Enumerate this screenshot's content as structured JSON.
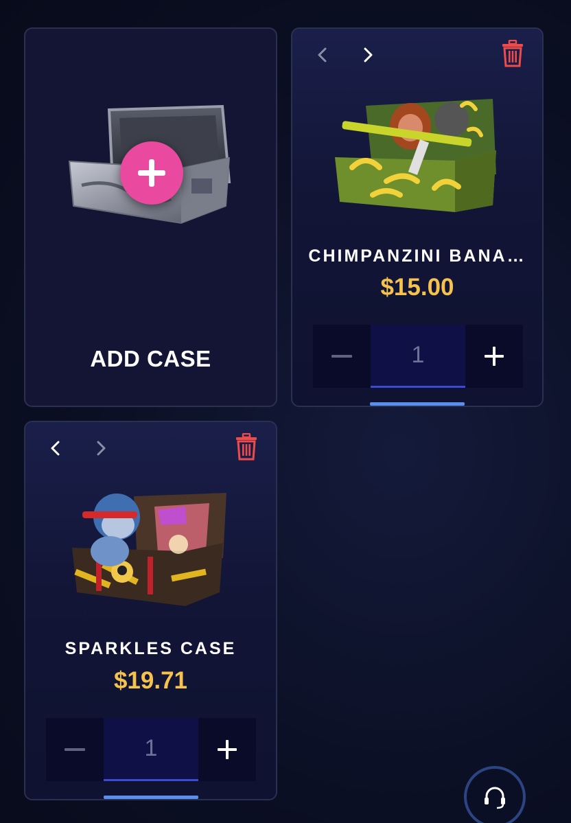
{
  "add_card": {
    "label": "ADD CASE",
    "icon": "plus-icon"
  },
  "cases": [
    {
      "name": "CHIMPANZINI BANA…",
      "price": "$15.00",
      "quantity": "1",
      "image": "banana-chimp-case"
    },
    {
      "name": "SPARKLES CASE",
      "price": "$19.71",
      "quantity": "1",
      "image": "ninja-sparkles-case"
    }
  ],
  "colors": {
    "accent_pink": "#e94aa0",
    "price_gold": "#f4c24d",
    "trash_red": "#ef4b4b",
    "progress_blue": "#5a8ff0"
  },
  "support": {
    "icon": "headset-icon"
  }
}
